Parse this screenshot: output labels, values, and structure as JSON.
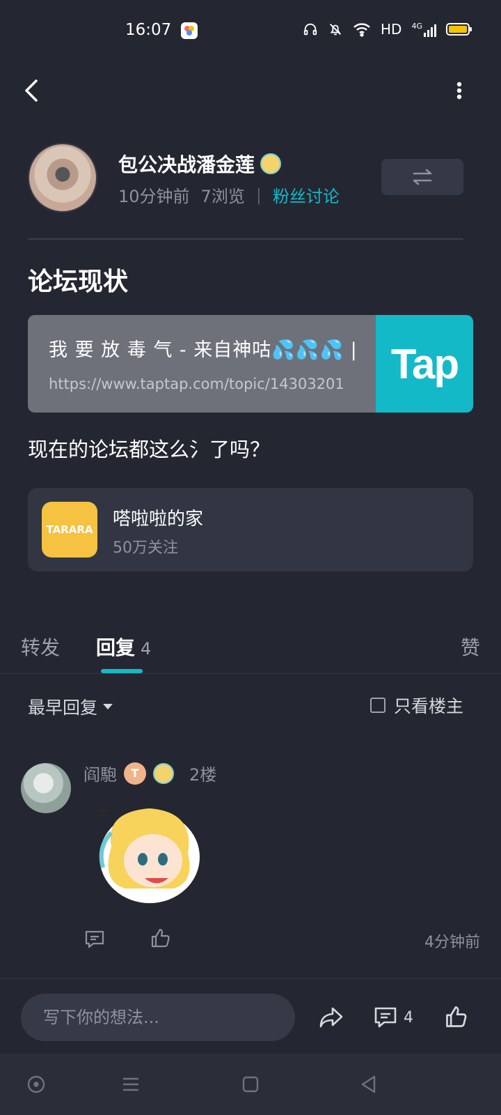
{
  "status_bar": {
    "time": "16:07",
    "network_label": "HD",
    "signal_label": "4G",
    "icons": [
      "headphones-icon",
      "mute-bell-icon",
      "wifi-icon",
      "signal-icon",
      "battery-icon"
    ],
    "battery_color": "#f5c400"
  },
  "author": {
    "name": "包公决战潘金莲",
    "time_ago": "10分钟前",
    "views": "7浏览",
    "separator": "|",
    "forum": "粉丝讨论"
  },
  "post": {
    "title": "论坛现状",
    "link_card": {
      "title": "我 要 放 毒 气 - 来自神咕💦💦💦 |…",
      "url": "https://www.taptap.com/topic/14303201",
      "thumb_text": "Tap"
    },
    "body": "现在的论坛都这么氵了吗？"
  },
  "group": {
    "logo_text": "TARARA",
    "name": "嗒啦啦的家",
    "followers": "50万关注"
  },
  "tabs": {
    "repost": "转发",
    "reply": "回复",
    "reply_count": "4",
    "like": "赞"
  },
  "filters": {
    "sort": "最早回复",
    "only_op": "只看楼主"
  },
  "replies": [
    {
      "name": "阎䮀",
      "level_badge": "T",
      "floor": "2楼",
      "time_ago": "4分钟前"
    }
  ],
  "bottom_bar": {
    "placeholder": "写下你的想法...",
    "comment_count": "4"
  },
  "colors": {
    "accent": "#14b9c8",
    "background": "#242731",
    "card": "#323642"
  }
}
